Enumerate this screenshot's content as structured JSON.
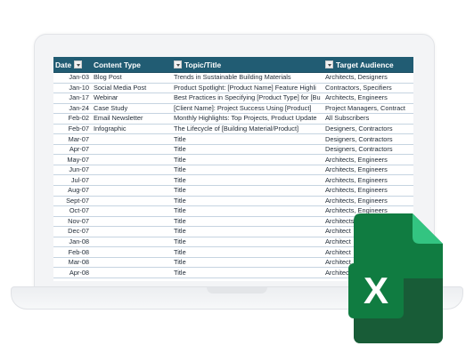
{
  "sheet": {
    "headers": {
      "date": "Date",
      "content_type": "Content Type",
      "topic": "Topic/Title",
      "audience": "Target Audience"
    },
    "rows": [
      {
        "date": "Jan-03",
        "type": "Blog Post",
        "topic": "Trends in Sustainable Building Materials",
        "audience": "Architects, Designers"
      },
      {
        "date": "Jan-10",
        "type": "Social Media Post",
        "topic": "Product Spotlight: [Product Name] Feature Highli",
        "audience": "Contractors, Specifiers"
      },
      {
        "date": "Jan-17",
        "type": "Webinar",
        "topic": "Best Practices in Specifying [Product Type] for [Bu",
        "audience": "Architects, Engineers"
      },
      {
        "date": "Jan-24",
        "type": "Case Study",
        "topic": "[Client Name]: Project Success Using [Product]",
        "audience": "Project Managers, Contract"
      },
      {
        "date": "Feb-02",
        "type": "Email Newsletter",
        "topic": "Monthly Highlights: Top Projects, Product Update",
        "audience": "All Subscribers"
      },
      {
        "date": "Feb-07",
        "type": "Infographic",
        "topic": "The Lifecycle of [Building Material/Product]",
        "audience": "Designers, Contractors"
      },
      {
        "date": "Mar-07",
        "type": "",
        "topic": "Title",
        "audience": "Designers, Contractors"
      },
      {
        "date": "Apr-07",
        "type": "",
        "topic": "Title",
        "audience": "Designers, Contractors"
      },
      {
        "date": "May-07",
        "type": "",
        "topic": "Title",
        "audience": "Architects, Engineers"
      },
      {
        "date": "Jun-07",
        "type": "",
        "topic": "Title",
        "audience": "Architects, Engineers"
      },
      {
        "date": "Jul-07",
        "type": "",
        "topic": "Title",
        "audience": "Architects, Engineers"
      },
      {
        "date": "Aug-07",
        "type": "",
        "topic": "Title",
        "audience": "Architects, Engineers"
      },
      {
        "date": "Sept-07",
        "type": "",
        "topic": "Title",
        "audience": "Architects, Engineers"
      },
      {
        "date": "Oct-07",
        "type": "",
        "topic": "Title",
        "audience": "Architects, Engineers"
      },
      {
        "date": "Nov-07",
        "type": "",
        "topic": "Title",
        "audience": "Architects, Engineers"
      },
      {
        "date": "Dec-07",
        "type": "",
        "topic": "Title",
        "audience": "Architect"
      },
      {
        "date": "Jan-08",
        "type": "",
        "topic": "Title",
        "audience": "Architect"
      },
      {
        "date": "Feb-08",
        "type": "",
        "topic": "Title",
        "audience": "Architect"
      },
      {
        "date": "Mar-08",
        "type": "",
        "topic": "Title",
        "audience": "Architect"
      },
      {
        "date": "Apr-08",
        "type": "",
        "topic": "Title",
        "audience": "Architect"
      }
    ]
  },
  "excel_logo": {
    "letter": "X",
    "colors": {
      "dark_green": "#185c37",
      "green": "#21a366",
      "mid_green": "#107c41",
      "fold": "#33c481",
      "header": "#215c73"
    }
  }
}
